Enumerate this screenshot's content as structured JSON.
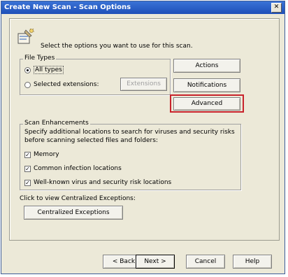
{
  "window": {
    "title": "Create New Scan - Scan Options",
    "close_glyph": "✕"
  },
  "header": {
    "instruction": "Select the options you want to use for this scan."
  },
  "file_types": {
    "title": "File Types",
    "all_types_label": "All types",
    "selected_label": "Selected extensions:",
    "selected_value": "all_types",
    "extensions_button": "Extensions"
  },
  "side_buttons": {
    "actions": "Actions",
    "notifications": "Notifications",
    "advanced": "Advanced"
  },
  "scan_enhancements": {
    "title": "Scan Enhancements",
    "description_line1": "Specify additional locations to search for viruses and security risks",
    "description_line2": "before scanning selected files and folders:",
    "options": [
      {
        "label": "Memory",
        "checked": true
      },
      {
        "label": "Common infection locations",
        "checked": true
      },
      {
        "label": "Well-known virus and security risk locations",
        "checked": true
      }
    ]
  },
  "exceptions": {
    "prompt": "Click to view Centralized Exceptions:",
    "button": "Centralized Exceptions"
  },
  "footer": {
    "back": "< Back",
    "next": "Next >",
    "cancel": "Cancel",
    "help": "Help"
  },
  "colors": {
    "title_bar": "#2a5fc9",
    "highlight": "#c8232c",
    "dialog_bg": "#ece9d8"
  }
}
